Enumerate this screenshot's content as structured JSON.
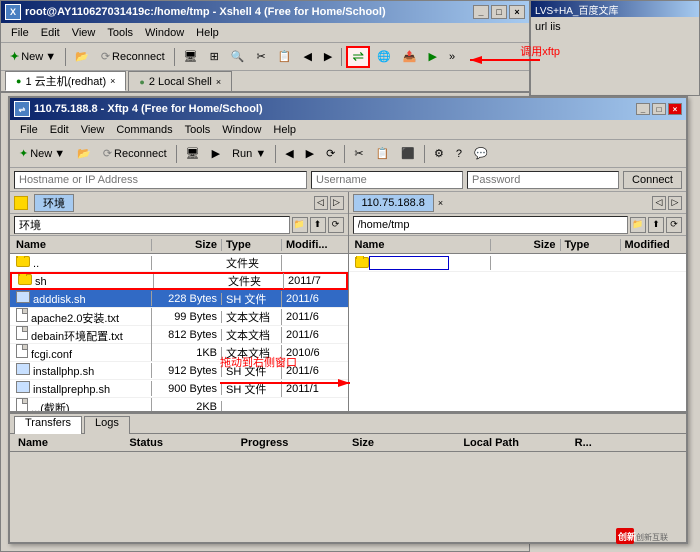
{
  "xshell": {
    "title": "root@AY110627031419c:/home/tmp - Xshell 4 (Free for Home/School)",
    "menu": [
      "File",
      "Edit",
      "View",
      "Tools",
      "Window",
      "Help"
    ],
    "tabs": [
      {
        "label": "1 云主机(redhat)",
        "active": true
      },
      {
        "label": "2 Local Shell",
        "active": false
      }
    ]
  },
  "xftp": {
    "title": "110.75.188.8 - Xftp 4 (Free for Home/School)",
    "menu": [
      "File",
      "Edit",
      "View",
      "Commands",
      "Tools",
      "Window",
      "Help"
    ],
    "toolbar": {
      "new_label": "New",
      "reconnect_label": "Reconnect",
      "run_label": "Run ▼"
    },
    "addr_bar": {
      "hostname_placeholder": "Hostname or IP Address",
      "username_placeholder": "Username",
      "password_placeholder": "Password",
      "connect_label": "Connect"
    }
  },
  "left_panel": {
    "title": "环境",
    "path": "环境",
    "columns": [
      "Name",
      "Size",
      "Type",
      "Modified"
    ],
    "files": [
      {
        "name": "..",
        "size": "",
        "type": "文件夹",
        "modified": "",
        "icon": "folder"
      },
      {
        "name": "sh",
        "size": "",
        "type": "文件夹",
        "modified": "2011/7",
        "icon": "folder",
        "highlighted": true
      },
      {
        "name": "adddisk.sh",
        "size": "228 Bytes",
        "type": "SH 文件",
        "modified": "2011/6",
        "icon": "sh"
      },
      {
        "name": "apache2.0安装.txt",
        "size": "99 Bytes",
        "type": "文本文档",
        "modified": "2011/6",
        "icon": "file"
      },
      {
        "name": "debain环境配置.txt",
        "size": "812 Bytes",
        "type": "文本文档",
        "modified": "2011/6",
        "icon": "file"
      },
      {
        "name": "fcgi.conf",
        "size": "1KB",
        "type": "文本文档",
        "modified": "2010/6",
        "icon": "file"
      },
      {
        "name": "installphp.sh",
        "size": "912 Bytes",
        "type": "SH 文件",
        "modified": "2011/6",
        "icon": "sh"
      },
      {
        "name": "installprephp.sh",
        "size": "900 Bytes",
        "type": "SH 文件",
        "modified": "2011/1",
        "icon": "sh"
      },
      {
        "name": "...(截断)",
        "size": "2KB",
        "type": "",
        "modified": "",
        "icon": "file"
      }
    ]
  },
  "right_panel": {
    "title": "110.75.188.8",
    "path": "/home/tmp",
    "columns": [
      "Name",
      "Size",
      "Type",
      "Modified"
    ],
    "files": [
      {
        "name": "",
        "size": "",
        "type": "",
        "modified": "",
        "icon": "folder",
        "editing": true
      }
    ]
  },
  "transfer": {
    "tabs": [
      "Transfers",
      "Logs"
    ],
    "active_tab": "Transfers",
    "columns": [
      "Name",
      "Status",
      "Progress",
      "Size",
      "Local Path",
      "Remote"
    ]
  },
  "right_partial": {
    "title": "LVS+HA_百度文库",
    "content": "url   iis"
  },
  "annotations": {
    "xftp_label": "调用xftp",
    "drag_label": "拖动到右侧窗口"
  }
}
